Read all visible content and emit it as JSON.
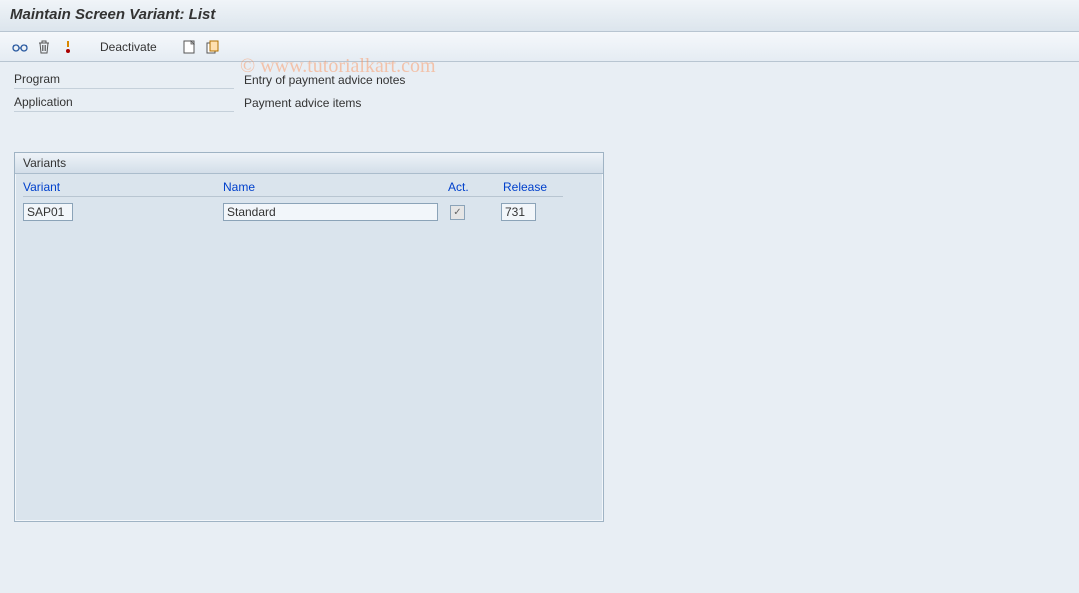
{
  "title": "Maintain Screen Variant: List",
  "watermark": "© www.tutorialkart.com",
  "toolbar": {
    "deactivate_label": "Deactivate"
  },
  "info": {
    "program_label": "Program",
    "program_value": "Entry of payment advice notes",
    "application_label": "Application",
    "application_value": "Payment advice items"
  },
  "variants": {
    "panel_title": "Variants",
    "columns": {
      "variant": "Variant",
      "name": "Name",
      "act": "Act.",
      "release": "Release"
    },
    "rows": [
      {
        "variant": "SAP01",
        "name": "Standard",
        "active": true,
        "release": "731"
      }
    ]
  }
}
